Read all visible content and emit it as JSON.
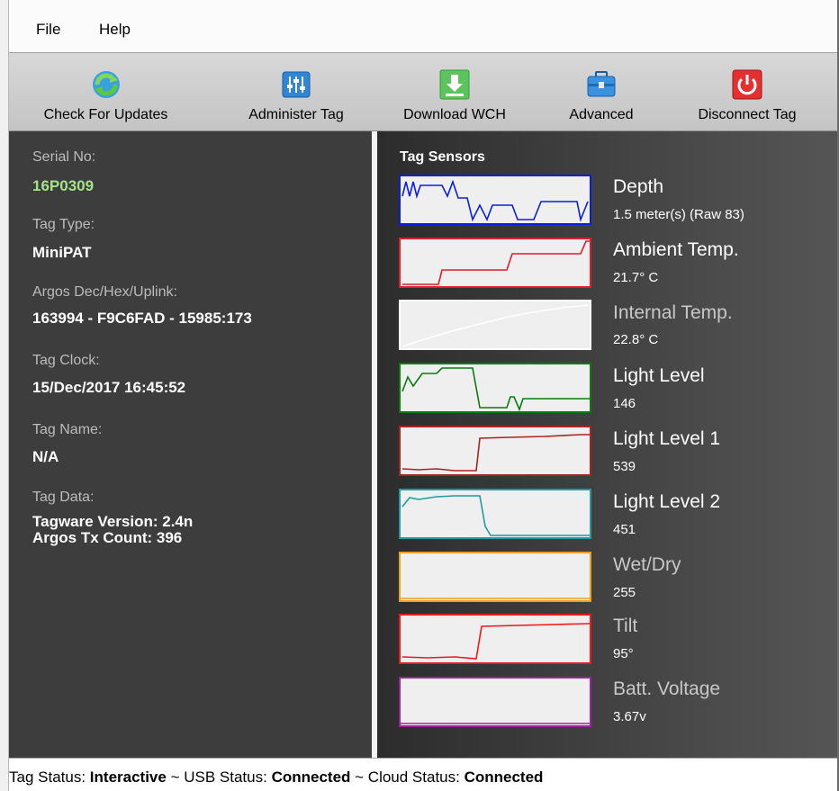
{
  "menu": {
    "file": "File",
    "help": "Help"
  },
  "toolbar": {
    "check_updates": "Check For Updates",
    "administer_tag": "Administer Tag",
    "download_wch": "Download WCH",
    "advanced": "Advanced",
    "disconnect_tag": "Disconnect Tag"
  },
  "tag_info": {
    "serial_label": "Serial No:",
    "serial_value": "16P0309",
    "type_label": "Tag Type:",
    "type_value": "MiniPAT",
    "argos_label": "Argos Dec/Hex/Uplink:",
    "argos_value": "163994 - F9C6FAD - 15985:173",
    "clock_label": "Tag Clock:",
    "clock_value": "15/Dec/2017 16:45:52",
    "name_label": "Tag Name:",
    "name_value": "N/A",
    "data_label": "Tag Data:",
    "data_line1": "Tagware Version: 2.4n",
    "data_line2": "Argos Tx Count: 396"
  },
  "sensors": {
    "title": "Tag Sensors",
    "items": [
      {
        "name": "Depth",
        "value": "1.5 meter(s) (Raw 83)",
        "color": "#0a1ee0"
      },
      {
        "name": "Ambient Temp.",
        "value": "21.7° C",
        "color": "#e21c2c"
      },
      {
        "name": "Internal Temp.",
        "value": "22.8° C",
        "color": "#ffffff"
      },
      {
        "name": "Light Level",
        "value": "146",
        "color": "#0c7a0c"
      },
      {
        "name": "Light Level 1",
        "value": "539",
        "color": "#a82424"
      },
      {
        "name": "Light Level 2",
        "value": "451",
        "color": "#1f9c9c"
      },
      {
        "name": "Wet/Dry",
        "value": "255",
        "color": "#f0a020"
      },
      {
        "name": "Tilt",
        "value": "95°",
        "color": "#f01818"
      },
      {
        "name": "Batt. Voltage",
        "value": "3.67v",
        "color": "#a020a0"
      }
    ]
  },
  "status": {
    "tag_label": "Tag Status:",
    "tag_value": "Interactive",
    "usb_label": "~ USB Status:",
    "usb_value": "Connected",
    "cloud_label": "~ Cloud Status:",
    "cloud_value": "Connected"
  }
}
